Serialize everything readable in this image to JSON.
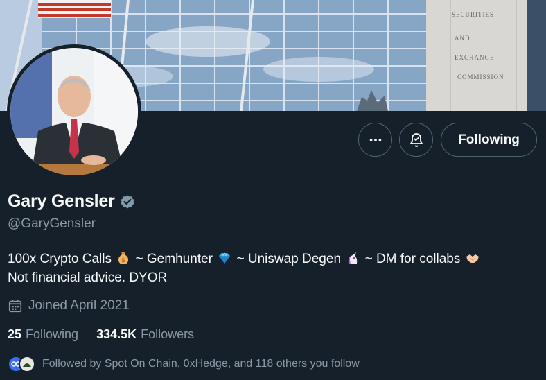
{
  "profile": {
    "display_name": "Gary Gensler",
    "handle": "@GaryGensler",
    "verified": true,
    "bio": {
      "part1": "100x Crypto Calls",
      "part2": "~ Gemhunter",
      "part3": "~ Uniswap Degen",
      "part4": "~ DM for collabs",
      "line2": "Not financial advice. DYOR"
    },
    "joined": "Joined April 2021",
    "following_count": "25",
    "following_label": "Following",
    "followers_count": "334.5K",
    "followers_label": "Followers",
    "followed_by": "Followed by Spot On Chain, 0xHedge, and 118 others you follow"
  },
  "banner": {
    "sign_lines": [
      "SECURITIES",
      "AND",
      "EXCHANGE",
      "COMMISSION"
    ]
  },
  "actions": {
    "following_button": "Following",
    "more_icon": "more-horizontal-icon",
    "notify_icon": "bell-check-icon"
  },
  "colors": {
    "background": "#15202b",
    "primary_text": "#f7f9f9",
    "secondary_text": "#8b98a5",
    "border": "#536471",
    "verified_badge": "#829aab"
  }
}
